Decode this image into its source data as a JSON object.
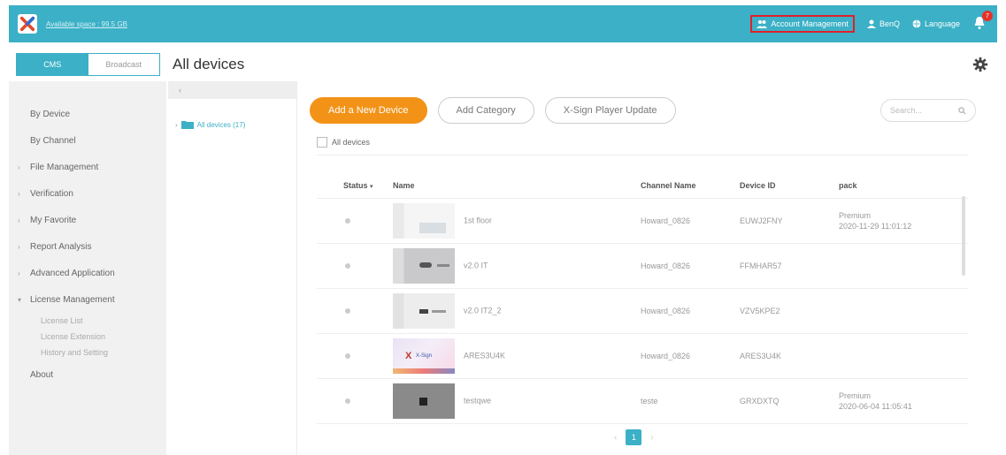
{
  "topbar": {
    "available_space": "Available space : 99.5 GB",
    "account_management": "Account Management",
    "user": "BenQ",
    "language": "Language",
    "notifications": "7"
  },
  "header": {
    "tabs": [
      {
        "label": "CMS"
      },
      {
        "label": "Broadcast"
      }
    ],
    "title": "All devices"
  },
  "sidebar": {
    "items": [
      {
        "label": "By Device"
      },
      {
        "label": "By Channel"
      },
      {
        "label": "File Management"
      },
      {
        "label": "Verification"
      },
      {
        "label": "My Favorite"
      },
      {
        "label": "Report Analysis"
      },
      {
        "label": "Advanced Application"
      },
      {
        "label": "License Management"
      }
    ],
    "license_sub": [
      {
        "label": "License List"
      },
      {
        "label": "License Extension"
      },
      {
        "label": "History and Setting"
      }
    ],
    "about": "About"
  },
  "tree": {
    "collapse": "‹",
    "root": "All devices (17)"
  },
  "toolbar": {
    "add_device": "Add a New Device",
    "add_category": "Add Category",
    "player_update": "X-Sign Player Update",
    "search_placeholder": "Search..."
  },
  "table": {
    "select_all": "All devices",
    "columns": {
      "status": "Status",
      "name": "Name",
      "channel": "Channel Name",
      "device_id": "Device ID",
      "pack": "pack"
    },
    "rows": [
      {
        "name": "1st floor",
        "channel": "Howard_0826",
        "device_id": "EUWJ2FNY",
        "pack_type": "Premium",
        "pack_date": "2020-11-29 11:01:12"
      },
      {
        "name": "v2.0 IT",
        "channel": "Howard_0826",
        "device_id": "FFMHAR57",
        "pack_type": "",
        "pack_date": ""
      },
      {
        "name": "v2.0 IT2_2",
        "channel": "Howard_0826",
        "device_id": "VZV5KPE2",
        "pack_type": "",
        "pack_date": ""
      },
      {
        "name": "ARES3U4K",
        "channel": "Howard_0826",
        "device_id": "ARES3U4K",
        "pack_type": "",
        "pack_date": ""
      },
      {
        "name": "testqwe",
        "channel": "teste",
        "device_id": "GRXDXTQ",
        "pack_type": "Premium",
        "pack_date": "2020-06-04 11:05:41"
      }
    ]
  },
  "pagination": {
    "prev": "‹",
    "current": "1",
    "next": "›"
  },
  "colors": {
    "brand": "#3bb0c6",
    "primary_button": "#f29318",
    "highlight_border": "#e0202a",
    "badge": "#e5322a"
  }
}
